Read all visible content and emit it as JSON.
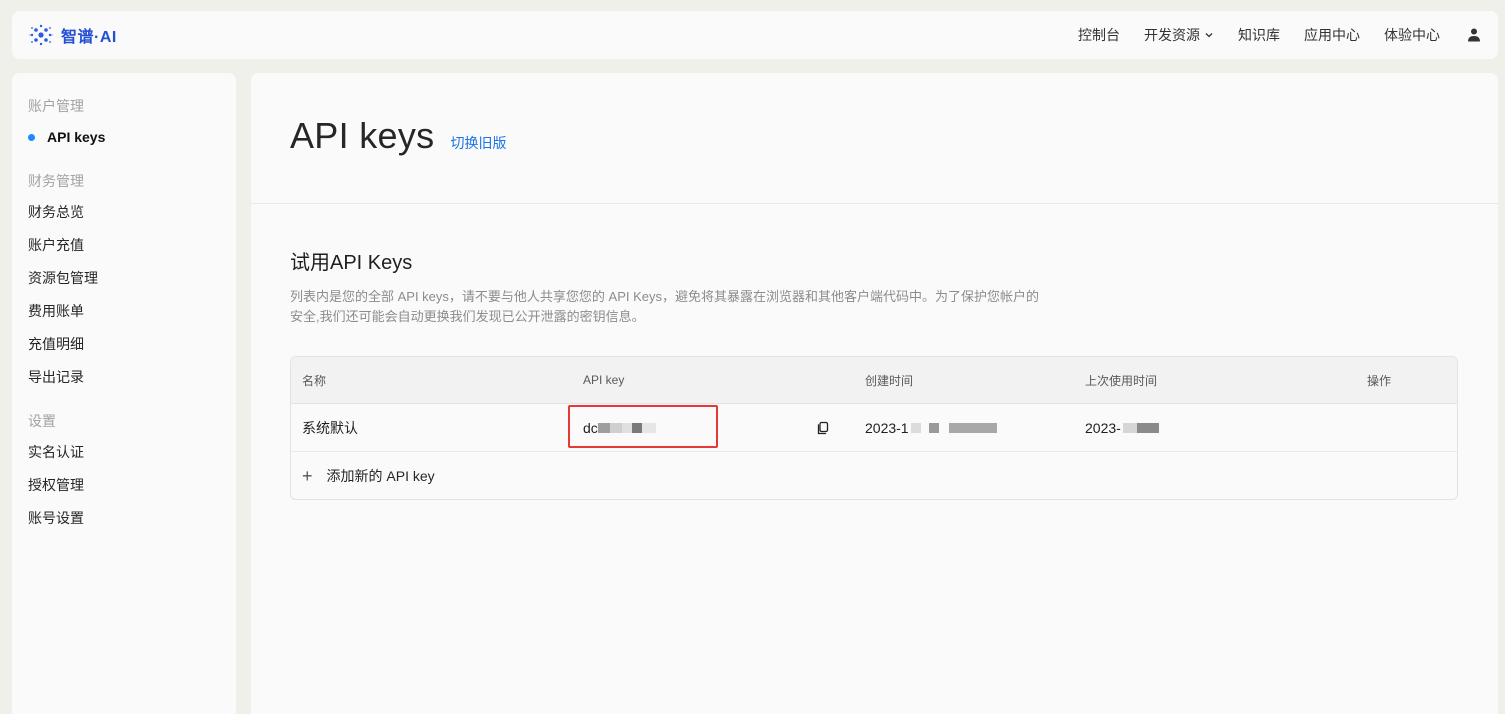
{
  "brand": {
    "name": "智谱·AI"
  },
  "topnav": {
    "items": [
      "控制台",
      "开发资源",
      "知识库",
      "应用中心",
      "体验中心"
    ]
  },
  "sidebar": {
    "group1": "账户管理",
    "item_apikeys": "API keys",
    "group2": "财务管理",
    "finance_items": [
      "财务总览",
      "账户充值",
      "资源包管理",
      "费用账单",
      "充值明细",
      "导出记录"
    ],
    "group3": "设置",
    "settings_items": [
      "实名认证",
      "授权管理",
      "账号设置"
    ]
  },
  "main": {
    "title": "API keys",
    "switch_link": "切换旧版",
    "section_title": "试用API Keys",
    "section_desc": "列表内是您的全部 API keys，请不要与他人共享您您的 API Keys，避免将其暴露在浏览器和其他客户端代码中。为了保护您帐户的安全,我们还可能会自动更换我们发现已公开泄露的密钥信息。"
  },
  "table": {
    "headers": [
      "名称",
      "API key",
      "创建时间",
      "上次使用时间",
      "操作"
    ],
    "rows": [
      {
        "name": "系统默认",
        "key_prefix": "dc",
        "created_prefix": "2023-1",
        "last_used_prefix": "2023-"
      }
    ],
    "add_label": "添加新的 API key"
  },
  "colors": {
    "accent": "#1a73e8",
    "brand": "#2450d4",
    "highlight_border": "#e53935"
  }
}
